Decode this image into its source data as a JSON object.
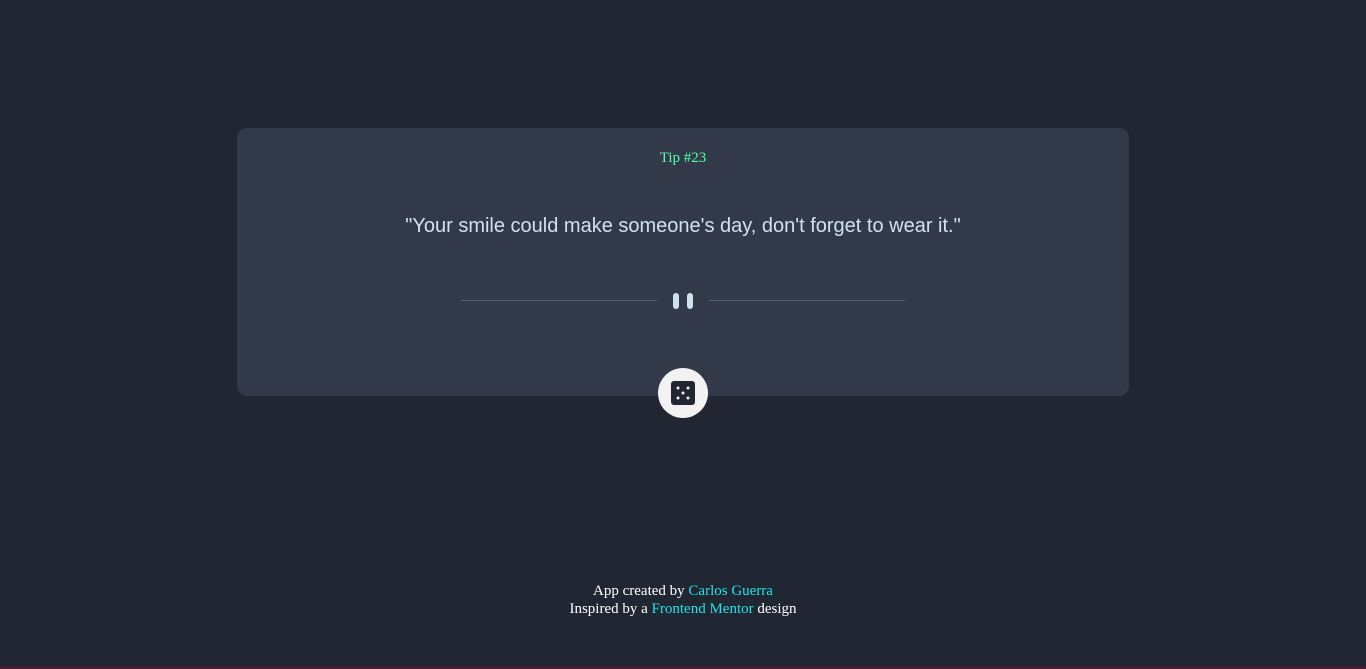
{
  "card": {
    "tip_label": "Tip #23",
    "advice": "\"Your smile could make someone's day, don't forget to wear it.\""
  },
  "dice_button": {
    "icon": "dice-five-icon",
    "aria_label": "Generate new advice"
  },
  "footer": {
    "line1_prefix": "App created by ",
    "author_link": "Carlos Guerra",
    "line2_prefix": "Inspired by a ",
    "source_link": "Frontend Mentor",
    "line2_suffix": " design"
  },
  "colors": {
    "background": "#202632",
    "card": "#323a49",
    "accent_green": "#52ffa8",
    "text_light": "#cee3e9",
    "link_cyan": "#1fe3e8",
    "divider": "#4f5d74"
  }
}
